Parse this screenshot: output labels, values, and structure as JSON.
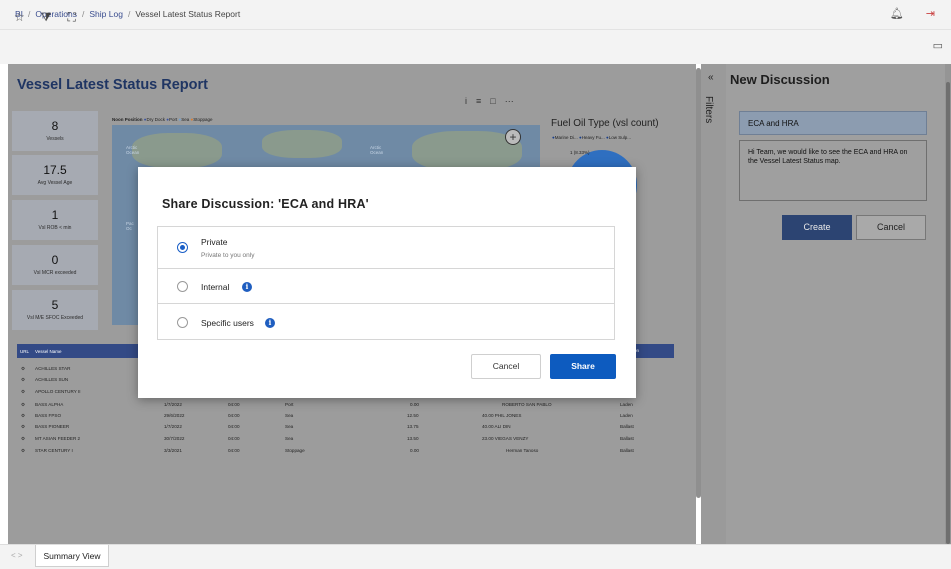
{
  "header": {
    "breadcrumb": [
      "BI",
      "Operations",
      "Ship Log",
      "Vessel Latest Status Report"
    ],
    "icons": [
      "bell-icon",
      "logout-icon"
    ]
  },
  "toolbar": {
    "icons": [
      "star-icon",
      "filter-icon",
      "fullscreen-icon",
      "comment-icon"
    ]
  },
  "report": {
    "title": "Vessel Latest Status Report",
    "kpis": [
      {
        "value": "8",
        "label": "Vessels"
      },
      {
        "value": "17.5",
        "label": "Avg Vessel Age"
      },
      {
        "value": "1",
        "label": "Vsl ROB < min"
      },
      {
        "value": "0",
        "label": "Vsl MCR exceeded"
      },
      {
        "value": "5",
        "label": "Vsl M/E SFOC Exceeded"
      }
    ],
    "map": {
      "legend_title": "Noon Position",
      "legend_items": [
        "Dry Dock",
        "Port",
        "Sea",
        "Stoppage"
      ],
      "legend_colors": [
        "#3a52a0",
        "#3a52a0",
        "#6fa3d8",
        "#e07b2a"
      ],
      "labels": [
        "Arctic Ocean",
        "Arctic Ocean",
        "Pac Oc"
      ],
      "zoom_symbol": "+"
    },
    "fuel_chart": {
      "title": "Fuel Oil Type (vsl count)",
      "legend": [
        "Marine Di...",
        "Heavy Fu...",
        "Low Sulp..."
      ],
      "slice_label": "1 (8.33%)",
      "side_labels": [
        "s",
        "(50%)"
      ]
    },
    "count_chart": {
      "title_fragment": "ount)",
      "legend_fragment": "ppage",
      "label_fragment": "5%)"
    },
    "table": {
      "head_left": [
        "URL",
        "Vessel Name"
      ],
      "head_right": "Condition",
      "rows": [
        {
          "name": "ACHILLES STAR",
          "date": "",
          "time": "",
          "status": "",
          "speed": "",
          "capt": "",
          "cond": ""
        },
        {
          "name": "ACHILLES SUN",
          "date": "",
          "time": "",
          "status": "",
          "speed": "",
          "capt": "",
          "cond": ""
        },
        {
          "name": "APOLLO CENTURY II",
          "date": "",
          "time": "",
          "status": "",
          "speed": "",
          "capt": "",
          "cond": ""
        },
        {
          "name": "BASS ALPHA",
          "date": "1/7/2022",
          "time": "04:00",
          "status": "Port",
          "speed": "0.00",
          "capt": "ROBERTO SAN PABLO",
          "cond": "Laden"
        },
        {
          "name": "BASS FPSO",
          "date": "29/6/2022",
          "time": "04:00",
          "status": "Sea",
          "speed": "12.50",
          "capt": "40.00  PHIL JONES",
          "cond": "Laden"
        },
        {
          "name": "BASS PIONEER",
          "date": "1/7/2022",
          "time": "04:00",
          "status": "Sea",
          "speed": "13.75",
          "capt": "40.00  ALI DIN",
          "cond": "Ballast"
        },
        {
          "name": "MT ASIAN FEEDER 2",
          "date": "30/7/2022",
          "time": "04:00",
          "status": "Sea",
          "speed": "13.50",
          "capt": "23.00  VIEGAS VENZY",
          "cond": "Ballast"
        },
        {
          "name": "STAR CENTURY I",
          "date": "3/3/2021",
          "time": "04:00",
          "status": "Stoppage",
          "speed": "0.00",
          "capt": "Herman Tanoso",
          "cond": "Ballast"
        }
      ]
    }
  },
  "tabs": {
    "nav": "< >",
    "active": "Summary View"
  },
  "filters": {
    "chevron": "«",
    "label": "Filters"
  },
  "discussion": {
    "title": "New Discussion",
    "subject_value": "ECA and HRA",
    "body_value": "Hi Team, we would like to see the ECA and HRA on the Vessel Latest Status map.",
    "create_label": "Create",
    "cancel_label": "Cancel"
  },
  "modal": {
    "title": "Share Discussion: 'ECA and HRA'",
    "options": [
      {
        "label": "Private",
        "sublabel": "Private to you only",
        "selected": true
      },
      {
        "label": "Internal",
        "selected": false
      },
      {
        "label": "Specific users",
        "selected": false
      }
    ],
    "cancel_label": "Cancel",
    "share_label": "Share",
    "info_glyph": "i"
  }
}
